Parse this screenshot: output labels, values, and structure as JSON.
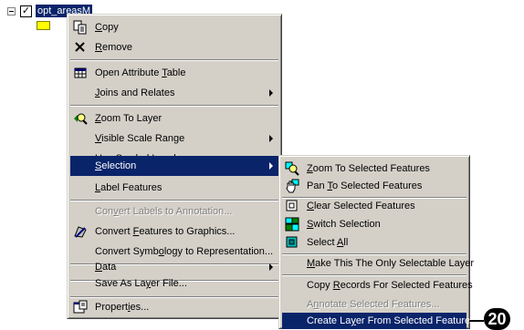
{
  "layer": {
    "name": "opt_areasM",
    "checked": true,
    "swatch_color": "#ffff00"
  },
  "main_menu": {
    "items": [
      {
        "id": "copy",
        "pre": "",
        "u": "C",
        "post": "opy",
        "icon": "copy-icon"
      },
      {
        "id": "remove",
        "pre": "",
        "u": "R",
        "post": "emove",
        "icon": "remove-icon"
      },
      {
        "id": "open-attribute-table",
        "pre": "Open Attribute ",
        "u": "T",
        "post": "able",
        "icon": "table-icon"
      },
      {
        "id": "joins-and-relates",
        "pre": "",
        "u": "J",
        "post": "oins and Relates",
        "submenu": true
      },
      {
        "id": "zoom-to-layer",
        "pre": "",
        "u": "Z",
        "post": "oom To Layer",
        "icon": "zoom-to-layer-icon"
      },
      {
        "id": "visible-scale-range",
        "pre": "",
        "u": "V",
        "post": "isible Scale Range",
        "submenu": true
      },
      {
        "id": "use-symbol-levels",
        "pre": "Use ",
        "u": "S",
        "post": "ymbol Levels"
      },
      {
        "id": "selection",
        "pre": "",
        "u": "S",
        "post": "election",
        "submenu": true,
        "highlighted": true
      },
      {
        "id": "label-features",
        "pre": "",
        "u": "L",
        "post": "abel Features"
      },
      {
        "id": "convert-labels-to-annotation",
        "pre": "Con",
        "u": "v",
        "post": "ert Labels to Annotation...",
        "disabled": true
      },
      {
        "id": "convert-features-to-graphics",
        "pre": "Convert ",
        "u": "F",
        "post": "eatures to Graphics...",
        "icon": "convert-graphics-icon"
      },
      {
        "id": "convert-symbology-to-representation",
        "pre": "Convert Symb",
        "u": "o",
        "post": "logy to Representation..."
      },
      {
        "id": "data",
        "pre": "",
        "u": "D",
        "post": "ata",
        "submenu": true
      },
      {
        "id": "save-as-layer-file",
        "pre": "Save As La",
        "u": "y",
        "post": "er File..."
      },
      {
        "id": "properties",
        "pre": "Propert",
        "u": "i",
        "post": "es...",
        "icon": "properties-icon"
      }
    ]
  },
  "selection_submenu": {
    "items": [
      {
        "id": "zoom-to-selected-features",
        "pre": "",
        "u": "Z",
        "post": "oom To Selected Features",
        "icon": "zoom-selected-icon"
      },
      {
        "id": "pan-to-selected-features",
        "pre": "Pan ",
        "u": "T",
        "post": "o Selected Features",
        "icon": "pan-hand-icon"
      },
      {
        "id": "clear-selected-features",
        "pre": "",
        "u": "C",
        "post": "lear Selected Features",
        "icon": "clear-selection-icon"
      },
      {
        "id": "switch-selection",
        "pre": "",
        "u": "S",
        "post": "witch Selection",
        "icon": "switch-selection-icon"
      },
      {
        "id": "select-all",
        "pre": "Select ",
        "u": "A",
        "post": "ll",
        "icon": "select-all-icon"
      },
      {
        "id": "make-only-selectable",
        "pre": "",
        "u": "M",
        "post": "ake This The Only Selectable Layer"
      },
      {
        "id": "copy-records",
        "pre": "Copy ",
        "u": "R",
        "post": "ecords For Selected Features"
      },
      {
        "id": "annotate-selected",
        "pre": "A",
        "u": "n",
        "post": "notate Selected Features...",
        "disabled": true
      },
      {
        "id": "create-layer",
        "pre": "Create La",
        "u": "y",
        "post": "er From Selected Features",
        "highlighted": true
      }
    ]
  },
  "callout": {
    "number": "20"
  }
}
